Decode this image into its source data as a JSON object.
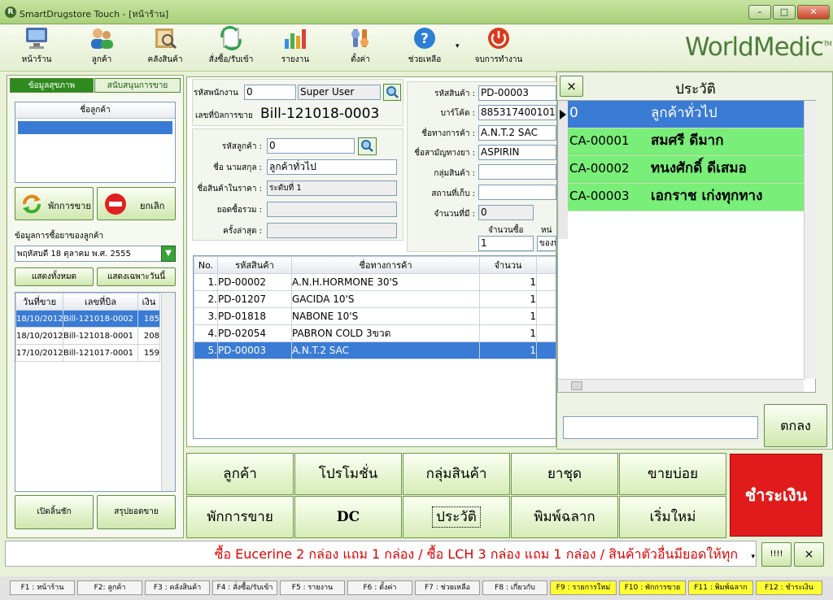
{
  "window": {
    "title": "SmartDrugstore Touch - [หน้าร้าน]",
    "icon": "R"
  },
  "toolbar": [
    {
      "label": "หน้าร้าน",
      "icon": "monitor-icon"
    },
    {
      "label": "ลูกค้า",
      "icon": "customers-icon"
    },
    {
      "label": "คลังสินค้า",
      "icon": "warehouse-icon"
    },
    {
      "label": "สั่งซื้อ/รับเข้า",
      "icon": "order-icon"
    },
    {
      "label": "รายงาน",
      "icon": "report-icon"
    },
    {
      "label": "ตั้งค่า",
      "icon": "settings-icon"
    },
    {
      "label": "ช่วยเหลือ",
      "icon": "help-icon"
    },
    {
      "label": "จบการทำงาน",
      "icon": "power-icon"
    }
  ],
  "brand": "WorldMedic",
  "brand_tm": "TM",
  "left": {
    "tab_health": "ข้อมูลสุขภาพ",
    "tab_support": "สนับสนุนการขาย",
    "customer_list_header": "ชื่อลูกค้า",
    "hold_sale": "พักการขาย",
    "cancel": "ยกเลิก",
    "purchase_info_label": "ข้อมูลการซื้อยาของลูกค้า",
    "date_select": "พฤหัสบดี 18 ตุลาคม พ.ศ. 2555",
    "show_all": "แสดงทั้งหมด",
    "show_today": "แสดงเฉพาะวันนี้",
    "bill_headers": [
      "วันที่ขาย",
      "เลขที่บิล",
      "เงิน"
    ],
    "bills": [
      [
        "18/10/2012",
        "Bill-121018-0002",
        "185"
      ],
      [
        "18/10/2012",
        "Bill-121018-0001",
        "208"
      ],
      [
        "17/10/2012",
        "Bill-121017-0001",
        "159"
      ]
    ],
    "open_drawer": "เปิดลิ้นชัก",
    "summary": "สรุปยอดขาย"
  },
  "form": {
    "employee_code_label": "รหัสพนักงาน",
    "employee_code": "0",
    "employee_name": "Super User",
    "bill_no_label": "เลขที่บิลการขาย",
    "bill_no": "Bill-121018-0003",
    "customer_code_label": "รหัสลูกค้า :",
    "customer_code": "0",
    "customer_name_label": "ชื่อ นามสกุล :",
    "customer_name": "ลูกค้าทั่วไป",
    "price_level_label": "ชื่อสินค้าในราคา :",
    "price_level": "ระดับที่ 1",
    "total_purchase_label": "ยอดซื้อรวม :",
    "last_time_label": "ครั้งล่าสุด :",
    "product_code_label": "รหัสสินค้า :",
    "product_code": "PD-00003",
    "barcode_label": "บาร์โค้ด :",
    "barcode": "8853174001012",
    "trade_name_label": "ชื่อทางการค้า :",
    "trade_name": "A.N.T.2 SAC",
    "generic_name_label": "ชื่อสามัญทางยา :",
    "generic_name": "ASPIRIN",
    "product_group_label": "กลุ่มสินค้า :",
    "storage_label": "สถานที่เก็บ :",
    "on_hand_label": "จำนวนที่มี :",
    "on_hand": "0",
    "qty_label": "จำนวนซื้อ",
    "qty": "1",
    "unit_label": "หน่",
    "unit": "ของห"
  },
  "items": {
    "headers": [
      "No.",
      "รหัสสินค้า",
      "ชื่อทางการค้า",
      "จำนวน"
    ],
    "rows": [
      [
        "1.",
        "PD-00002",
        "A.N.H.HORMONE 30'S",
        "1"
      ],
      [
        "2.",
        "PD-01207",
        "GACIDA 10'S",
        "1"
      ],
      [
        "3.",
        "PD-01818",
        "NABONE 10'S",
        "1"
      ],
      [
        "4.",
        "PD-02054",
        "PABRON COLD 3ขวด",
        "1"
      ],
      [
        "5.",
        "PD-00003",
        "A.N.T.2 SAC",
        "1"
      ]
    ]
  },
  "history": {
    "close": "×",
    "title": "ประวัติ",
    "rows": [
      [
        "0",
        "ลูกค้าทั่วไป"
      ],
      [
        "CA-00001",
        "สมศรี ดีมาก"
      ],
      [
        "CA-00002",
        "ทนงศักดิ์ ดีเสมอ"
      ],
      [
        "CA-00003",
        "เอกราช เก่งทุกทาง"
      ]
    ],
    "ok": "ตกลง"
  },
  "actions": {
    "customer": "ลูกค้า",
    "promotion": "โปรโมชั่น",
    "product_group": "กลุ่มสินค้า",
    "drug_set": "ยาชุด",
    "frequent": "ขายบ่อย",
    "hold": "พักการขาย",
    "dc": "DC",
    "history": "ประวัติ",
    "print_label": "พิมพ์ฉลาก",
    "restart": "เริ่มใหม่",
    "pay": "ชำระเงิน"
  },
  "marquee": "ซื้อ Eucerine 2 กล่อง แถม 1 กล่อง / ซื้อ LCH 3 กล่อง แถม 1 กล่อง / สินค้าตัวอื่นมียอดให้ทุก",
  "marquee_btn1": "!!!!",
  "marquee_btn2": "×",
  "fkeys": [
    "F1 : หน้าร้าน",
    "F2: ลูกค้า",
    "F3 : คลังสินค้า",
    "F4 : สั่งซื้อ/รับเข้า",
    "F5 : รายงาน",
    "F6 : ตั้งค่า",
    "F7 : ช่วยเหลือ",
    "F8 : เกี่ยวกับ",
    "F9 : รายการใหม่",
    "F10 : พักการขาย",
    "F11 : พิมพ์ฉลาก",
    "F12 : ชำระเงิน"
  ],
  "colors": {
    "accent_green": "#1f7a0f",
    "selected": "#3878d8",
    "history_row": "#79ee79",
    "pay": "#e11b1b",
    "marquee_text": "#e00000"
  }
}
